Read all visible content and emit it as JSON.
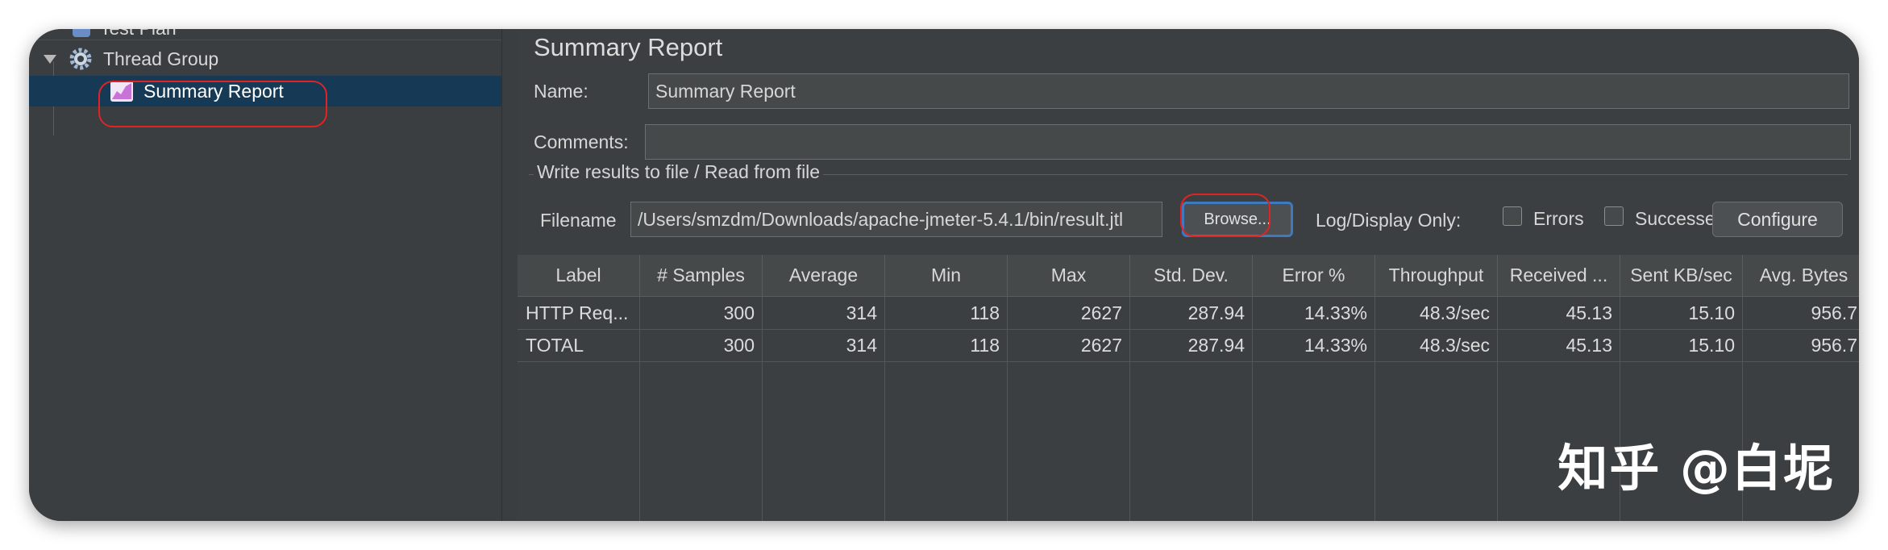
{
  "tree": {
    "items": [
      {
        "label": "Test Plan"
      },
      {
        "label": "Thread Group"
      },
      {
        "label": "Summary Report"
      }
    ]
  },
  "panel": {
    "title": "Summary Report",
    "name_label": "Name:",
    "name_value": "Summary Report",
    "comments_label": "Comments:",
    "comments_value": "",
    "group_title": "Write results to file / Read from file",
    "filename_label": "Filename",
    "filename_value": "/Users/smzdm/Downloads/apache-jmeter-5.4.1/bin/result.jtl",
    "browse_label": "Browse...",
    "log_display_label": "Log/Display Only:",
    "errors_label": "Errors",
    "successes_label": "Successes",
    "configure_label": "Configure"
  },
  "table": {
    "headers": [
      "Label",
      "# Samples",
      "Average",
      "Min",
      "Max",
      "Std. Dev.",
      "Error %",
      "Throughput",
      "Received ...",
      "Sent KB/sec",
      "Avg. Bytes"
    ],
    "rows": [
      [
        "HTTP Req...",
        "300",
        "314",
        "118",
        "2627",
        "287.94",
        "14.33%",
        "48.3/sec",
        "45.13",
        "15.10",
        "956.7"
      ],
      [
        "TOTAL",
        "300",
        "314",
        "118",
        "2627",
        "287.94",
        "14.33%",
        "48.3/sec",
        "45.13",
        "15.10",
        "956.7"
      ]
    ]
  },
  "watermark": "知乎 @白坭",
  "colors": {
    "background": "#3c3f41",
    "selection": "#163a55",
    "annotation": "#e02424",
    "focus_border": "#3d7ac0"
  }
}
